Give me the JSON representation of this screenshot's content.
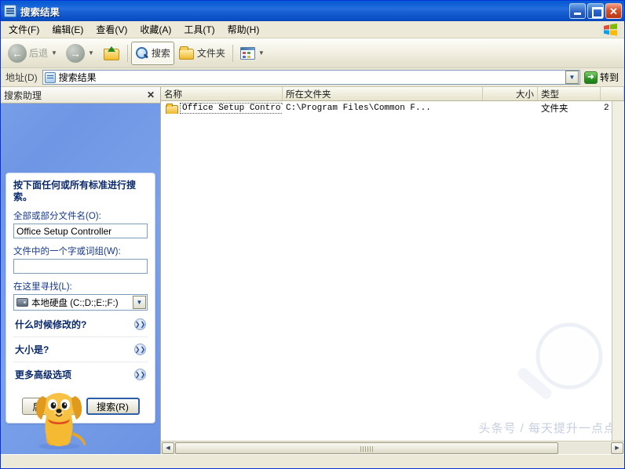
{
  "window": {
    "title": "搜索结果",
    "icon": "search-results-icon",
    "buttons": {
      "minimize": "最小化",
      "maximize": "最大化",
      "close": "关闭"
    }
  },
  "menubar": {
    "items": [
      {
        "label": "文件(F)",
        "name": "menu-file"
      },
      {
        "label": "编辑(E)",
        "name": "menu-edit"
      },
      {
        "label": "查看(V)",
        "name": "menu-view"
      },
      {
        "label": "收藏(A)",
        "name": "menu-favorites"
      },
      {
        "label": "工具(T)",
        "name": "menu-tools"
      },
      {
        "label": "帮助(H)",
        "name": "menu-help"
      }
    ],
    "logo_icon": "windows-logo-icon"
  },
  "toolbar": {
    "back_label": "后退",
    "forward_label": "",
    "up_label": "",
    "search_label": "搜索",
    "folders_label": "文件夹",
    "views_label": ""
  },
  "addressbar": {
    "label": "地址(D)",
    "value": "搜索结果",
    "go_label": "转到"
  },
  "search_pane": {
    "header_title": "搜索助理",
    "close_label": "✕",
    "prompt": "按下面任何或所有标准进行搜索。",
    "filename_label": "全部或部分文件名(O):",
    "filename_value": "Office Setup Controller",
    "filename_placeholder": "",
    "word_label": "文件中的一个字或词组(W):",
    "word_value": "",
    "word_placeholder": "",
    "lookin_label": "在这里寻找(L):",
    "lookin_value": "本地硬盘 (C:;D:;E:;F:)",
    "sections": [
      {
        "label": "什么时候修改的?",
        "name": "section-date-modified"
      },
      {
        "label": "大小是?",
        "name": "section-size"
      },
      {
        "label": "更多高级选项",
        "name": "section-advanced"
      }
    ],
    "back_button": "后退(B)",
    "search_button": "搜索(R)",
    "assistant_icon": "search-dog-assistant"
  },
  "file_list": {
    "columns": [
      {
        "label": "名称",
        "name": "column-name"
      },
      {
        "label": "所在文件夹",
        "name": "column-in-folder"
      },
      {
        "label": "大小",
        "name": "column-size"
      },
      {
        "label": "类型",
        "name": "column-type"
      },
      {
        "label": "",
        "name": "column-date-modified"
      }
    ],
    "rows": [
      {
        "name": "Office Setup Controller",
        "folder": "C:\\Program Files\\Common F...",
        "size": "",
        "type": "文件夹",
        "date": "2",
        "icon": "folder-icon",
        "selected": true
      }
    ],
    "watermark": "头条号 / 每天提升一点点",
    "watermark_icon": "magnifier-watermark"
  }
}
